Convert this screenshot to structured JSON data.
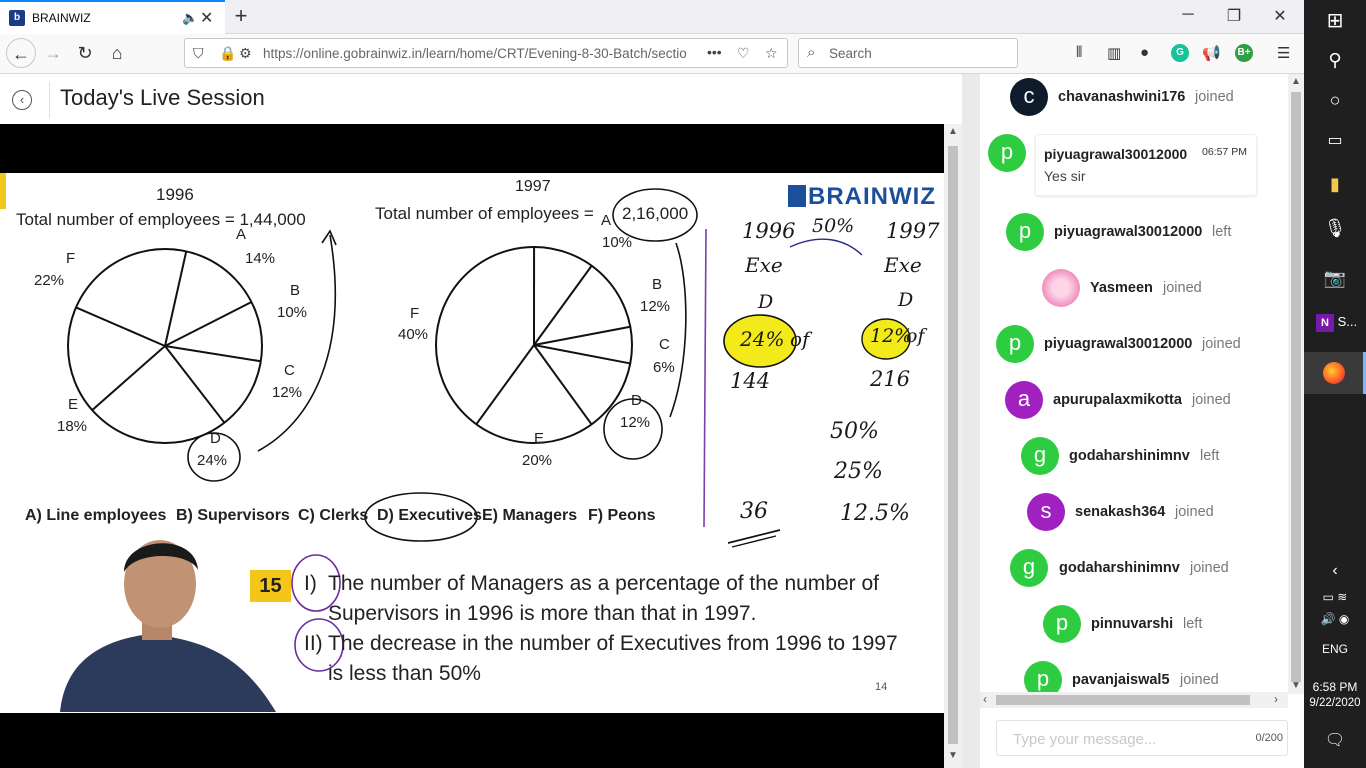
{
  "browser": {
    "tab_title": "BRAINWIZ",
    "tab_favicon": "b",
    "url": "https://online.gobrainwiz.in/learn/home/CRT/Evening-8-30-Batch/sectio",
    "url_more": "•••",
    "search_placeholder": "Search",
    "ext_grammarly": "G",
    "ext_b": "B+"
  },
  "page": {
    "title": "Today's Live Session"
  },
  "slide": {
    "logo": "BRAINWIZ",
    "chart1_year": "1996",
    "chart1_total": "Total number of employees = 1,44,000",
    "chart2_year": "1997",
    "chart2_total_prefix": "Total number of employees =",
    "chart2_total_value": "2,16,000",
    "legend": [
      "A) Line employees",
      "B) Supervisors",
      "C) Clerks",
      "D) Executives",
      "E) Managers",
      "F) Peons"
    ],
    "q_number": "15",
    "q1_label": "I)",
    "q1_line1": "The number of Managers as a percentage of the number of",
    "q1_line2": "Supervisors in 1996 is more than that in 1997.",
    "q2_label": "II)",
    "q2_line1": "The decrease in the number of Executives from 1996 to 1997",
    "q2_line2": "is less than 50%",
    "page_no": "14",
    "notes": {
      "y1996": "1996",
      "p50": "50%",
      "y1997": "1997",
      "exe1": "Exe",
      "exe2": "Exe",
      "d1": "D",
      "d2": "D",
      "v24": "24%",
      "of1": "of",
      "v12": "12%",
      "of2": "of",
      "n144": "144",
      "n216": "216",
      "s50": "50%",
      "s25": "25%",
      "s125": "12.5%",
      "n36": "36"
    }
  },
  "chart_data": [
    {
      "type": "pie",
      "title": "1996",
      "subtitle": "Total number of employees = 1,44,000",
      "categories": [
        "A",
        "B",
        "C",
        "D",
        "E",
        "F"
      ],
      "values": [
        14,
        10,
        12,
        24,
        18,
        22
      ],
      "labels": [
        "A 14%",
        "B 10%",
        "C 12%",
        "D 24%",
        "E 18%",
        "F 22%"
      ]
    },
    {
      "type": "pie",
      "title": "1997",
      "subtitle": "Total number of employees = 2,16,000",
      "categories": [
        "A",
        "B",
        "C",
        "D",
        "E",
        "F"
      ],
      "values": [
        10,
        12,
        6,
        12,
        20,
        40
      ],
      "labels": [
        "A 10%",
        "B 12%",
        "C 6%",
        "D 12%",
        "E 20%",
        "F 40%"
      ]
    }
  ],
  "chat": {
    "entries": [
      {
        "initial": "c",
        "name": "chavanashwini176",
        "status": "joined",
        "color": "#0d1b2a"
      },
      {
        "initial": "p",
        "name": "piyuagrawal30012000",
        "time": "06:57 PM",
        "message": "Yes sir",
        "color": "#2ecc40"
      },
      {
        "initial": "p",
        "name": "piyuagrawal30012000",
        "status": "left",
        "color": "#2ecc40"
      },
      {
        "initial": "",
        "name": "Yasmeen",
        "status": "joined",
        "color": "#f4a6c8"
      },
      {
        "initial": "p",
        "name": "piyuagrawal30012000",
        "status": "joined",
        "color": "#2ecc40"
      },
      {
        "initial": "a",
        "name": "apurupalaxmikotta",
        "status": "joined",
        "color": "#a020c0"
      },
      {
        "initial": "g",
        "name": "godaharshinimnv",
        "status": "left",
        "color": "#2ecc40"
      },
      {
        "initial": "s",
        "name": "senakash364",
        "status": "joined",
        "color": "#a020c0"
      },
      {
        "initial": "g",
        "name": "godaharshinimnv",
        "status": "joined",
        "color": "#2ecc40"
      },
      {
        "initial": "p",
        "name": "pinnuvarshi",
        "status": "left",
        "color": "#2ecc40"
      },
      {
        "initial": "p",
        "name": "pavanjaiswal5",
        "status": "joined",
        "color": "#2ecc40"
      }
    ],
    "input_placeholder": "Type your message...",
    "char_count": "0/200"
  },
  "taskbar": {
    "onenote_label": "S...",
    "lang": "ENG",
    "time": "6:58 PM",
    "date": "9/22/2020"
  }
}
